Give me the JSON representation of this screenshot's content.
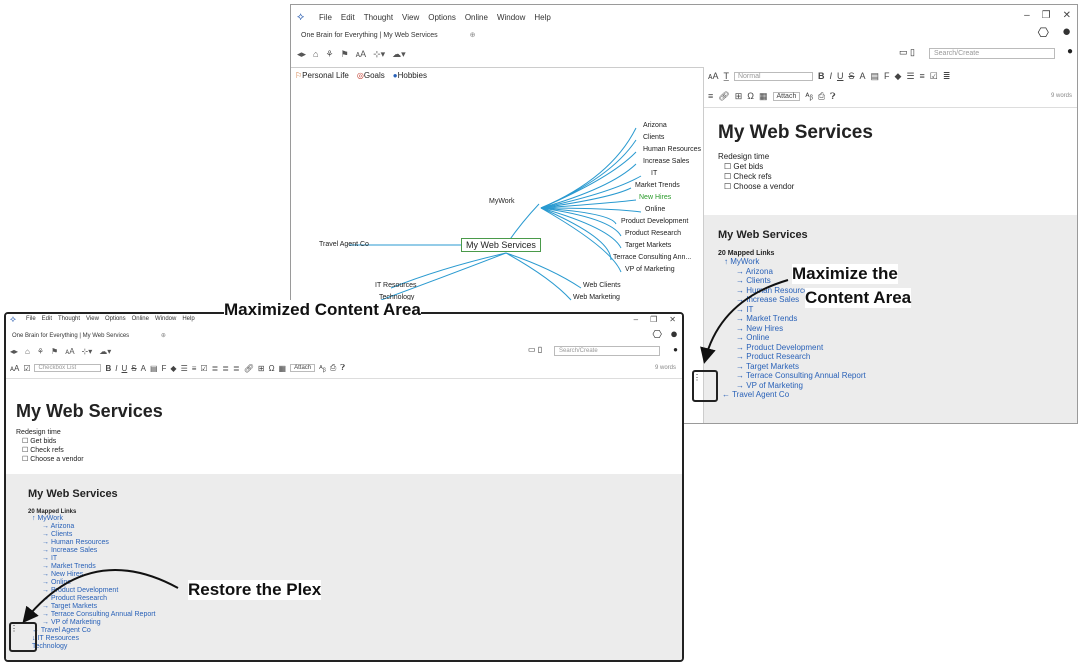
{
  "app": {
    "menu": [
      "File",
      "Edit",
      "Thought",
      "View",
      "Options",
      "Online",
      "Window",
      "Help"
    ],
    "tab_title": "One Brain for Everything | My Web Services",
    "search_placeholder": "Search/Create"
  },
  "pins": [
    {
      "label": "Personal Life",
      "color": "#d07030"
    },
    {
      "label": "Goals",
      "color": "#c0392b"
    },
    {
      "label": "Hobbies",
      "color": "#2a62b8"
    }
  ],
  "plex": {
    "central": "My Web Services",
    "parent": "MyWork",
    "left": "Travel Agent Co",
    "children": [
      "Arizona",
      "Clients",
      "Human Resources",
      "Increase Sales",
      "IT",
      "Market Trends",
      "New Hires",
      "Online",
      "Product Development",
      "Product Research",
      "Target Markets",
      "Terrace Consulting Ann...",
      "VP of Marketing"
    ],
    "below_left": [
      "IT Resources",
      "Technology"
    ],
    "below_right": [
      "Web Clients",
      "Web Marketing"
    ]
  },
  "editor": {
    "style_normal": "Normal",
    "style_checkbox": "Checkbox List",
    "attach": "Attach",
    "word_count": "9 words"
  },
  "note": {
    "title": "My Web Services",
    "body_intro": "Redesign time",
    "checklist": [
      "Get bids",
      "Check refs",
      "Choose a vendor"
    ]
  },
  "links": {
    "heading": "My Web Services",
    "count_label": "20 Mapped Links",
    "parent": "MyWork",
    "children": [
      "Arizona",
      "Clients",
      "Human Resources",
      "Increase Sales",
      "IT",
      "Market Trends",
      "New Hires",
      "Online",
      "Product Development",
      "Product Research",
      "Target Markets",
      "Terrace Consulting Annual Report",
      "VP of Marketing"
    ],
    "jump": "Travel Agent Co",
    "extra": [
      "IT Resources",
      "Technology"
    ]
  },
  "callouts": {
    "maximized": "Maximized Content Area",
    "maximize_line1": "Maximize the",
    "maximize_line2": "Content Area",
    "restore": "Restore the Plex"
  },
  "colors": {
    "link": "#2a62b8",
    "plex_line": "#2a9ad0",
    "green": "#2a9a2a"
  }
}
